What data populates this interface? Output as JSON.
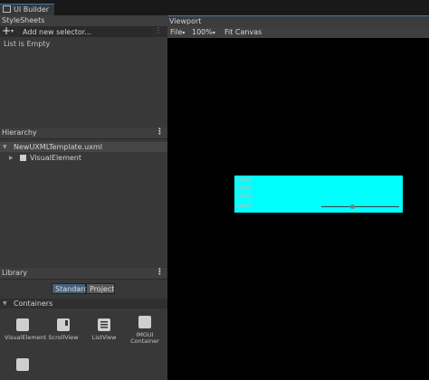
{
  "window": {
    "tab_title": "UI Builder"
  },
  "stylesheets": {
    "title": "StyleSheets",
    "add_button": "+",
    "add_caret": "▾",
    "selector_placeholder": "Add new selector...",
    "more_button": "⋮",
    "empty_text": "List is Empty"
  },
  "hierarchy": {
    "title": "Hierarchy",
    "menu": "⋮",
    "root": "NewUXMLTemplate.uxml",
    "child": "VisualElement"
  },
  "library": {
    "title": "Library",
    "menu": "⋮",
    "tabs": [
      "Standard",
      "Project"
    ],
    "active_tab": "Standard",
    "section": "Containers",
    "items": [
      "VisualElement",
      "ScrollView",
      "ListView",
      "IMGUI Container"
    ]
  },
  "viewport": {
    "title": "Viewport",
    "toolbar": {
      "file": "File",
      "file_caret": "▾",
      "zoom": "100%",
      "zoom_caret": "▾",
      "fit": "Fit Canvas"
    },
    "canvas": {
      "labels": [
        "Label",
        "Label",
        "Label",
        "Label"
      ],
      "background": "#00ffff",
      "slider_value": 0.4
    }
  },
  "colors": {
    "accent": "#3a79bb",
    "panel": "#383838",
    "canvas_bg": "#000000",
    "tab_selected": "#46607c"
  }
}
